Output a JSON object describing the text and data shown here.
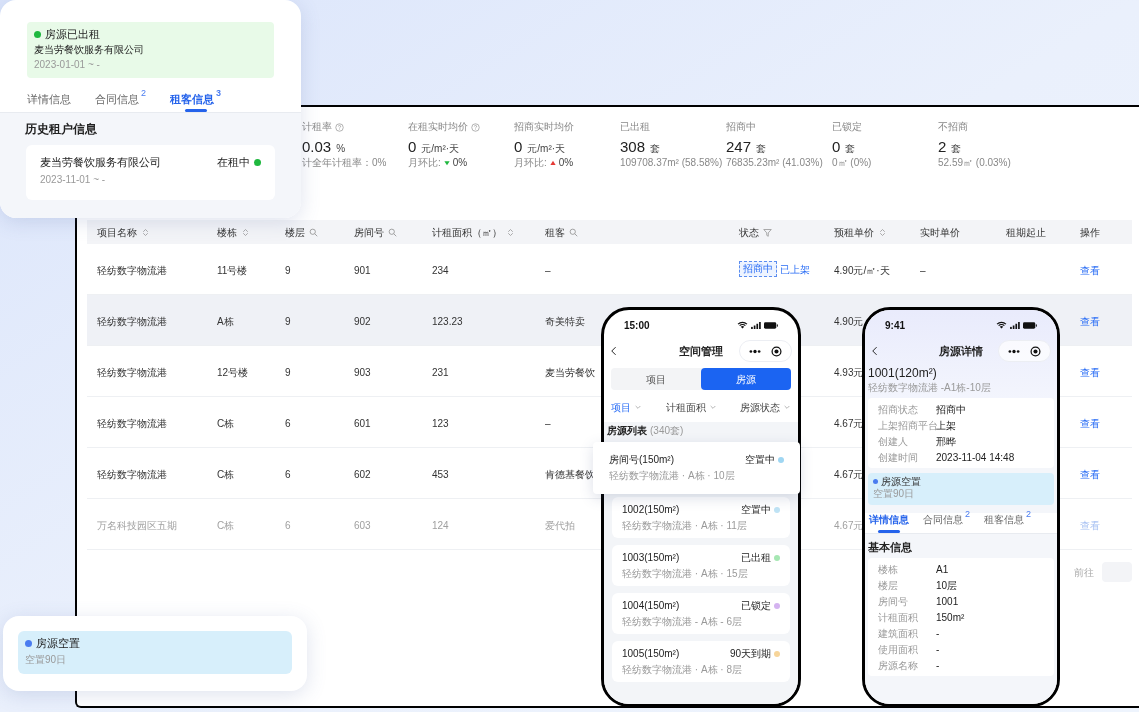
{
  "top_card": {
    "status_banner": {
      "title": "房源已出租",
      "tenant": "麦当劳餐饮服务有限公司",
      "period": "2023-01-01 ~ -",
      "color": "#1fb83f"
    },
    "tabs": [
      {
        "label": "详情信息",
        "selected": false
      },
      {
        "label": "合同信息",
        "badge": "2",
        "selected": false
      },
      {
        "label": "租客信息",
        "badge": "3",
        "selected": true
      }
    ],
    "section_title": "历史租户信息",
    "tenant_card": {
      "name": "麦当劳餐饮服务有限公司",
      "status": "在租中",
      "color": "#1fb83f",
      "period": "2023-11-01 ~ -"
    }
  },
  "stats": [
    {
      "kind": "rate",
      "label": "计租率",
      "value": "0.03",
      "unit": "%",
      "note": "计全年计租率：0%"
    },
    {
      "kind": "price_down",
      "label": "在租实时均价",
      "value": "0",
      "unit": "元/m²·天",
      "note": "月环比:",
      "change": "0%"
    },
    {
      "kind": "price_up",
      "label": "招商实时均价",
      "value": "0",
      "unit": "元/m²·天",
      "note": "月环比:",
      "change": "0%"
    },
    {
      "kind": "count",
      "label": "已出租",
      "value": "308",
      "unit": "套",
      "note": "109708.37m² (58.58%)"
    },
    {
      "kind": "count",
      "label": "招商中",
      "value": "247",
      "unit": "套",
      "note": "76835.23m² (41.03%)"
    },
    {
      "kind": "count",
      "label": "已锁定",
      "value": "0",
      "unit": "套",
      "note": "0㎡ (0%)"
    },
    {
      "kind": "count",
      "label": "不招商",
      "value": "2",
      "unit": "套",
      "note": "52.59㎡ (0.03%)"
    }
  ],
  "table": {
    "columns": [
      {
        "label": "项目名称"
      },
      {
        "label": "楼栋"
      },
      {
        "label": "楼层"
      },
      {
        "label": "房间号"
      },
      {
        "label": "计租面积（㎡）"
      },
      {
        "label": "租客"
      },
      {
        "label": "状态"
      },
      {
        "label": "预租单价"
      },
      {
        "label": "实时单价"
      },
      {
        "label": "租期起止"
      },
      {
        "label": "操作"
      }
    ],
    "rows": [
      {
        "cells": [
          "轻纺数字物流港",
          "11号楼",
          "9",
          "901",
          "234",
          "–"
        ],
        "status": {
          "tag": "招商中",
          "listing": "已上架"
        },
        "price": "4.90元/㎡·天",
        "realtime": "–",
        "action": "查看",
        "highlighted": false,
        "disabled": false
      },
      {
        "cells": [
          "轻纺数字物流港",
          "A栋",
          "9",
          "902",
          "123.23",
          "奇美特卖"
        ],
        "price": "4.90元",
        "action": "查看",
        "highlighted": true,
        "disabled": false
      },
      {
        "cells": [
          "轻纺数字物流港",
          "12号楼",
          "9",
          "903",
          "231",
          "麦当劳餐饮"
        ],
        "price": "4.93元",
        "action": "查看",
        "highlighted": false,
        "disabled": false
      },
      {
        "cells": [
          "轻纺数字物流港",
          "C栋",
          "6",
          "601",
          "123",
          "–"
        ],
        "price": "4.67元",
        "action": "查看",
        "highlighted": false,
        "disabled": false
      },
      {
        "cells": [
          "轻纺数字物流港",
          "C栋",
          "6",
          "602",
          "453",
          "肯德基餐饮"
        ],
        "price": "4.67元",
        "action": "查看",
        "highlighted": false,
        "disabled": false
      },
      {
        "cells": [
          "万名科技园区五期",
          "C栋",
          "6",
          "603",
          "124",
          "爱代拍"
        ],
        "price": "4.67元",
        "action": "查看",
        "highlighted": false,
        "disabled": true
      }
    ],
    "pager_label": "前往"
  },
  "phone_list": {
    "time": "15:00",
    "title": "空间管理",
    "segments": [
      {
        "label": "项目",
        "selected": false
      },
      {
        "label": "房源",
        "selected": true
      }
    ],
    "filters": [
      {
        "label": "项目",
        "selected": true
      },
      {
        "label": "计租面积",
        "selected": false
      },
      {
        "label": "房源状态",
        "selected": false
      }
    ],
    "list_title": "房源列表",
    "list_count": "(340套)",
    "items": [
      {
        "name": "房间号(150m²)",
        "location": "轻纺数字物流港 · A栋 · 10层",
        "status": "空置中",
        "color": "#9fd6f2",
        "raised": true
      },
      {
        "name": "1002(150m²)",
        "location": "轻纺数字物流港 · A栋 · 11层",
        "status": "空置中",
        "color": "#bfe3f5",
        "raised": false
      },
      {
        "name": "1003(150m²)",
        "location": "轻纺数字物流港 · A栋 · 15层",
        "status": "已出租",
        "color": "#a6e7b3",
        "raised": false
      },
      {
        "name": "1004(150m²)",
        "location": "轻纺数字物流港 - A栋 - 6层",
        "status": "已锁定",
        "color": "#d4b3f0",
        "raised": false
      },
      {
        "name": "1005(150m²)",
        "location": "轻纺数字物流港 · A栋 · 8层",
        "status": "90天到期",
        "color": "#f7d59a",
        "raised": false
      }
    ]
  },
  "phone_detail": {
    "time": "9:41",
    "title": "房源详情",
    "room": "1001(120m²)",
    "location": "轻纺数字物流港 -A1栋-10层",
    "info": [
      {
        "label": "招商状态",
        "value": "招商中"
      },
      {
        "label": "上架招商平台",
        "value": "上架"
      },
      {
        "label": "创建人",
        "value": "邢晔"
      },
      {
        "label": "创建时间",
        "value": "2023-11-04 14:48"
      }
    ],
    "banner": {
      "title": "房源空置",
      "note": "空置90日",
      "color": "#4a7cf0"
    },
    "tabs": [
      {
        "label": "详情信息",
        "selected": true
      },
      {
        "label": "合同信息",
        "badge": "2",
        "selected": false
      },
      {
        "label": "租客信息",
        "badge": "2",
        "selected": false
      }
    ],
    "section_title": "基本信息",
    "basic": [
      {
        "label": "楼栋",
        "value": "A1"
      },
      {
        "label": "楼层",
        "value": "10层"
      },
      {
        "label": "房间号",
        "value": "1001"
      },
      {
        "label": "计租面积",
        "value": "150m²"
      },
      {
        "label": "建筑面积",
        "value": "-"
      },
      {
        "label": "使用面积",
        "value": "-"
      },
      {
        "label": "房源名称",
        "value": "-"
      }
    ]
  },
  "bottom_card": {
    "title": "房源空置",
    "note": "空置90日",
    "color": "#4a7cf0"
  }
}
